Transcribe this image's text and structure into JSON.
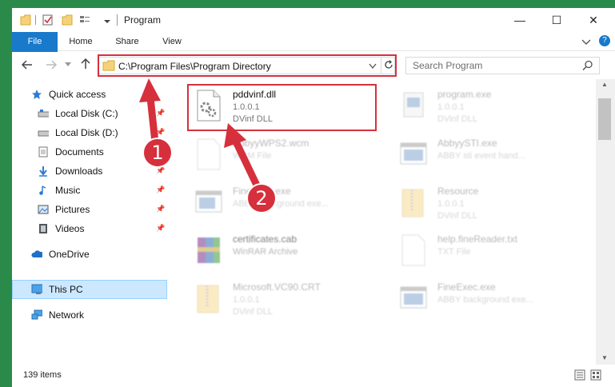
{
  "window": {
    "title": "Program",
    "controls": {
      "minimize": "—",
      "maximize": "☐",
      "close": "✕"
    }
  },
  "ribbon": {
    "tabs": [
      {
        "label": "File"
      },
      {
        "label": "Home"
      },
      {
        "label": "Share"
      },
      {
        "label": "View"
      }
    ],
    "help": "?"
  },
  "address": {
    "path": "C:\\Program Files\\Program Directory",
    "search_placeholder": "Search Program"
  },
  "nav": {
    "items": [
      {
        "label": "Quick access",
        "icon": "star-icon",
        "pinned": false
      },
      {
        "label": "Local Disk (C:)",
        "icon": "drive-icon",
        "pinned": true
      },
      {
        "label": "Local Disk (D:)",
        "icon": "drive-icon",
        "pinned": true
      },
      {
        "label": "Documents",
        "icon": "documents-icon",
        "pinned": true
      },
      {
        "label": "Downloads",
        "icon": "download-icon",
        "pinned": true
      },
      {
        "label": "Music",
        "icon": "music-icon",
        "pinned": true
      },
      {
        "label": "Pictures",
        "icon": "pictures-icon",
        "pinned": true
      },
      {
        "label": "Videos",
        "icon": "videos-icon",
        "pinned": true
      },
      {
        "label": "OneDrive",
        "icon": "cloud-icon"
      },
      {
        "label": "This PC",
        "icon": "computer-icon",
        "selected": true
      },
      {
        "label": "Network",
        "icon": "network-icon"
      }
    ]
  },
  "files": [
    {
      "name": "pddvinf.dll",
      "line2": "1.0.0.1",
      "line3": "DVinf DLL",
      "icon": "dll-gear-icon"
    },
    {
      "name": "program.exe",
      "line2": "1.0.0.1",
      "line3": "DVinf DLL",
      "icon": "exe-icon"
    },
    {
      "name": "AbbyyWPS2.wcm",
      "line2": "WCM File",
      "line3": "",
      "icon": "blank-file-icon"
    },
    {
      "name": "AbbyySTI.exe",
      "line2": "ABBY sti event hand...",
      "line3": "",
      "icon": "window-icon"
    },
    {
      "name": "FineExec.exe",
      "line2": "ABBY background exe...",
      "line3": "",
      "icon": "window-icon"
    },
    {
      "name": "Resource",
      "line2": "1.0.0.1",
      "line3": "DVinf DLL",
      "icon": "folder-zip-icon"
    },
    {
      "name": "certificates.cab",
      "line2": "WinRAR Archive",
      "line3": "",
      "icon": "rar-icon"
    },
    {
      "name": "help.fineReader.txt",
      "line2": "TXT File",
      "line3": "",
      "icon": "blank-file-icon"
    },
    {
      "name": "Microsoft.VC90.CRT",
      "line2": "1.0.0.1",
      "line3": "DVinf DLL",
      "icon": "folder-zip-icon"
    },
    {
      "name": "FineExec.exe",
      "line2": "ABBY background exe...",
      "line3": "",
      "icon": "window-icon"
    }
  ],
  "status": {
    "count": "139 items"
  },
  "annotations": {
    "step1": "1",
    "step2": "2"
  },
  "colors": {
    "accent": "#1979ca",
    "highlight": "#d5303c"
  }
}
